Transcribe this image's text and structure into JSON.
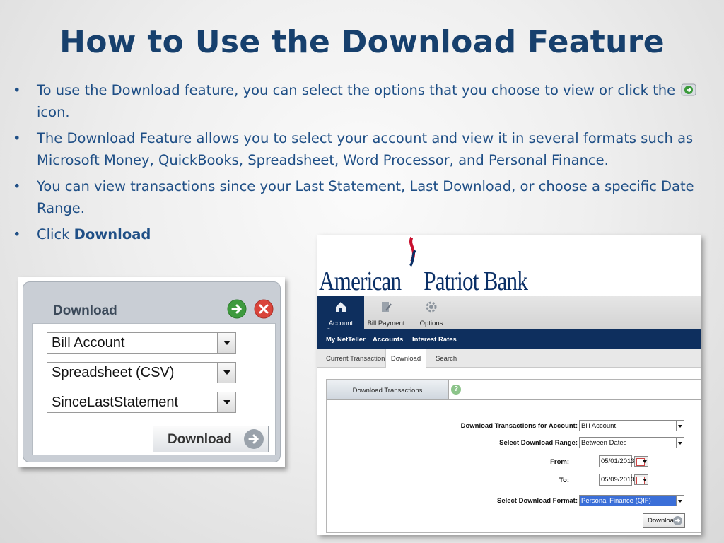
{
  "slide": {
    "title": "How to Use the Download Feature",
    "bullets": [
      {
        "before_icon": "To use the Download feature, you can select the options that you choose to view or click the",
        "icon": "green-go-arrow-icon",
        "after_icon": "icon."
      },
      {
        "text": "The Download Feature allows you to select your account and view it in several formats such as Microsoft Money, QuickBooks, Spreadsheet, Word Processor, and Personal Finance."
      },
      {
        "text": "You can view transactions since your Last Statement, Last Download, or choose a specific Date Range."
      },
      {
        "prefix": "Click",
        "bold": "Download"
      }
    ]
  },
  "widget": {
    "title": "Download",
    "account": "Bill Account",
    "format": "Spreadsheet (CSV)",
    "range": "SinceLastStatement",
    "download_label": "Download"
  },
  "bank": {
    "logo": {
      "american": "American",
      "patriot": "Patriot",
      "bank": "Bank"
    },
    "topnav": [
      "Account Summary",
      "Bill Payment",
      "Options"
    ],
    "subnav": [
      "My NetTeller",
      "Accounts",
      "Interest Rates"
    ],
    "tabs": [
      "Current Transactions",
      "Download",
      "Search"
    ],
    "panel_tab": "Download Transactions",
    "help": "?",
    "form": {
      "account_label": "Download Transactions for Account:",
      "account_value": "Bill Account",
      "range_label": "Select Download Range:",
      "range_value": "Between Dates",
      "from_label": "From:",
      "from_value": "05/01/2013",
      "to_label": "To:",
      "to_value": "05/09/2013",
      "format_label": "Select Download Format:",
      "format_value": "Personal Finance (QIF)",
      "download_label": "Download"
    }
  },
  "colors": {
    "title": "#17406d",
    "bullet_text": "#1f4f86",
    "navy": "#0e2f5e",
    "logo_red": "#c8102e"
  }
}
